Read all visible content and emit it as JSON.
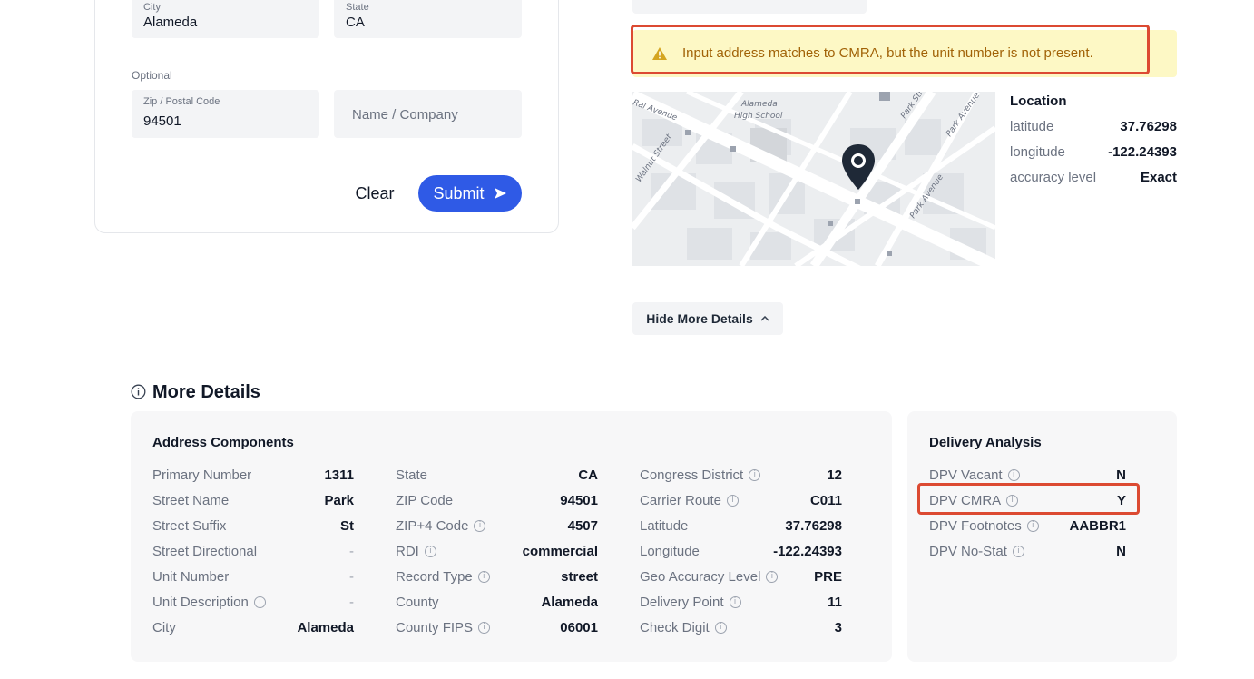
{
  "form": {
    "city": {
      "label": "City",
      "value": "Alameda"
    },
    "state": {
      "label": "State",
      "value": "CA"
    },
    "optional_label": "Optional",
    "zip": {
      "label": "Zip / Postal Code",
      "value": "94501"
    },
    "name_company": {
      "placeholder": "Name / Company"
    },
    "clear_label": "Clear",
    "submit_label": "Submit"
  },
  "warning": {
    "text": "Input address matches to CMRA, but the unit number is not present."
  },
  "map": {
    "labels": [
      "Alameda",
      "High School"
    ],
    "streets": [
      "Ral Avenue",
      "Walnut Street",
      "Park Street",
      "Park Avenue",
      "Park Avenue"
    ]
  },
  "location": {
    "title": "Location",
    "rows": [
      {
        "key": "latitude",
        "value": "37.76298"
      },
      {
        "key": "longitude",
        "value": "-122.24393"
      },
      {
        "key": "accuracy level",
        "value": "Exact"
      }
    ]
  },
  "hide_details_label": "Hide More Details",
  "more_details": {
    "title": "More Details",
    "address_components": {
      "title": "Address Components",
      "col1": [
        {
          "key": "Primary Number",
          "value": "1311"
        },
        {
          "key": "Street Name",
          "value": "Park"
        },
        {
          "key": "Street Suffix",
          "value": "St"
        },
        {
          "key": "Street Directional",
          "value": "-"
        },
        {
          "key": "Unit Number",
          "value": "-"
        },
        {
          "key": "Unit Description",
          "value": "-"
        },
        {
          "key": "City",
          "value": "Alameda"
        }
      ],
      "col2": [
        {
          "key": "State",
          "value": "CA"
        },
        {
          "key": "ZIP Code",
          "value": "94501"
        },
        {
          "key": "ZIP+4 Code",
          "value": "4507"
        },
        {
          "key": "RDI",
          "value": "commercial"
        },
        {
          "key": "Record Type",
          "value": "street"
        },
        {
          "key": "County",
          "value": "Alameda"
        },
        {
          "key": "County FIPS",
          "value": "06001"
        }
      ],
      "col3": [
        {
          "key": "Congress District",
          "value": "12"
        },
        {
          "key": "Carrier Route",
          "value": "C011"
        },
        {
          "key": "Latitude",
          "value": "37.76298"
        },
        {
          "key": "Longitude",
          "value": "-122.24393"
        },
        {
          "key": "Geo Accuracy Level",
          "value": "PRE"
        },
        {
          "key": "Delivery Point",
          "value": "11"
        },
        {
          "key": "Check Digit",
          "value": "3"
        }
      ]
    },
    "delivery_analysis": {
      "title": "Delivery Analysis",
      "rows": [
        {
          "key": "DPV Vacant",
          "value": "N"
        },
        {
          "key": "DPV CMRA",
          "value": "Y"
        },
        {
          "key": "DPV Footnotes",
          "value": "AABBR1"
        },
        {
          "key": "DPV No-Stat",
          "value": "N"
        }
      ]
    }
  },
  "colors": {
    "primary": "#2f5ae6",
    "warning_bg": "#fdf8c5",
    "warning_text": "#a16207",
    "highlight": "#dc4a32"
  }
}
